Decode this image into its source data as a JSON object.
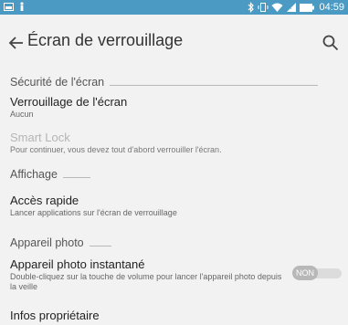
{
  "status_bar": {
    "time": "04:59",
    "icons": [
      "notification-icon",
      "person-icon",
      "bluetooth-icon",
      "vibrate-icon",
      "wifi-icon",
      "signal-icon",
      "battery-icon"
    ]
  },
  "app_bar": {
    "title": "Écran de verrouillage",
    "back_icon": "arrow-left-icon",
    "search_icon": "search-icon"
  },
  "sections": [
    {
      "header": "Sécurité de l'écran",
      "items": [
        {
          "title": "Verrouillage de l'écran",
          "subtitle": "Aucun",
          "enabled": true
        },
        {
          "title": "Smart Lock",
          "subtitle": "Pour continuer, vous devez tout d'abord verrouiller l'écran.",
          "enabled": false
        }
      ]
    },
    {
      "header": "Affichage",
      "items": [
        {
          "title": "Accès rapide",
          "subtitle": "Lancer applications sur l'écran de verrouillage",
          "enabled": true
        }
      ]
    },
    {
      "header": "Appareil photo",
      "items": [
        {
          "title": "Appareil photo instantané",
          "subtitle": "Double-cliquez sur la touche de volume pour lancer l'appareil photo depuis la veille",
          "enabled": true,
          "toggle": {
            "state": "NON",
            "on": false
          }
        }
      ]
    },
    {
      "items": [
        {
          "title": "Infos propriétaire",
          "enabled": true
        }
      ]
    }
  ],
  "colors": {
    "status_bar": "#4a9ac4",
    "background": "#f2f2f2",
    "divider": "#b9b9b9",
    "disabled_text": "#b5b5b5"
  }
}
